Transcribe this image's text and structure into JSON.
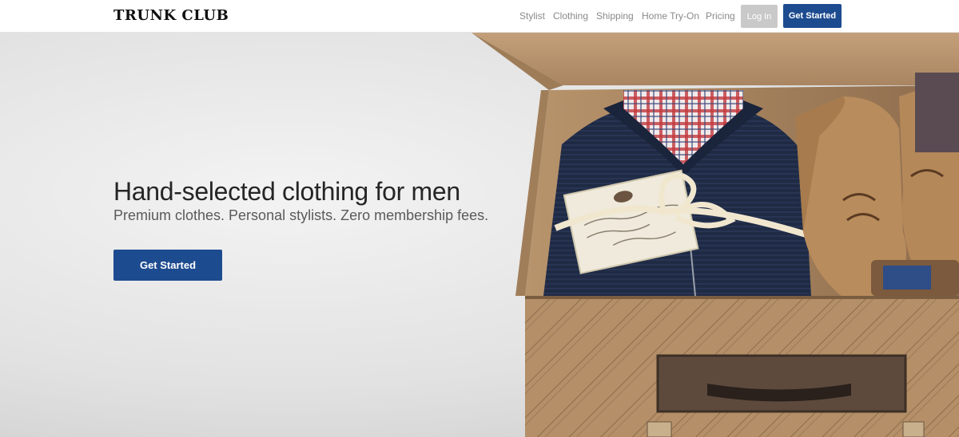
{
  "header": {
    "logo": "TRUNK CLUB",
    "nav": [
      "Stylist",
      "Clothing",
      "Shipping",
      "Home Try-On",
      "Pricing"
    ],
    "login_label": "Log In",
    "get_started_label": "Get Started"
  },
  "hero": {
    "title": "Hand-selected clothing for men",
    "subtitle": "Premium clothes. Personal stylists. Zero membership fees.",
    "cta_label": "Get Started",
    "image_label": "box-of-clothing-photo"
  },
  "colors": {
    "brand_blue": "#1d4b8f",
    "login_gray": "#c9c9c9",
    "nav_text": "#8a8a8a",
    "title_text": "#262626"
  }
}
